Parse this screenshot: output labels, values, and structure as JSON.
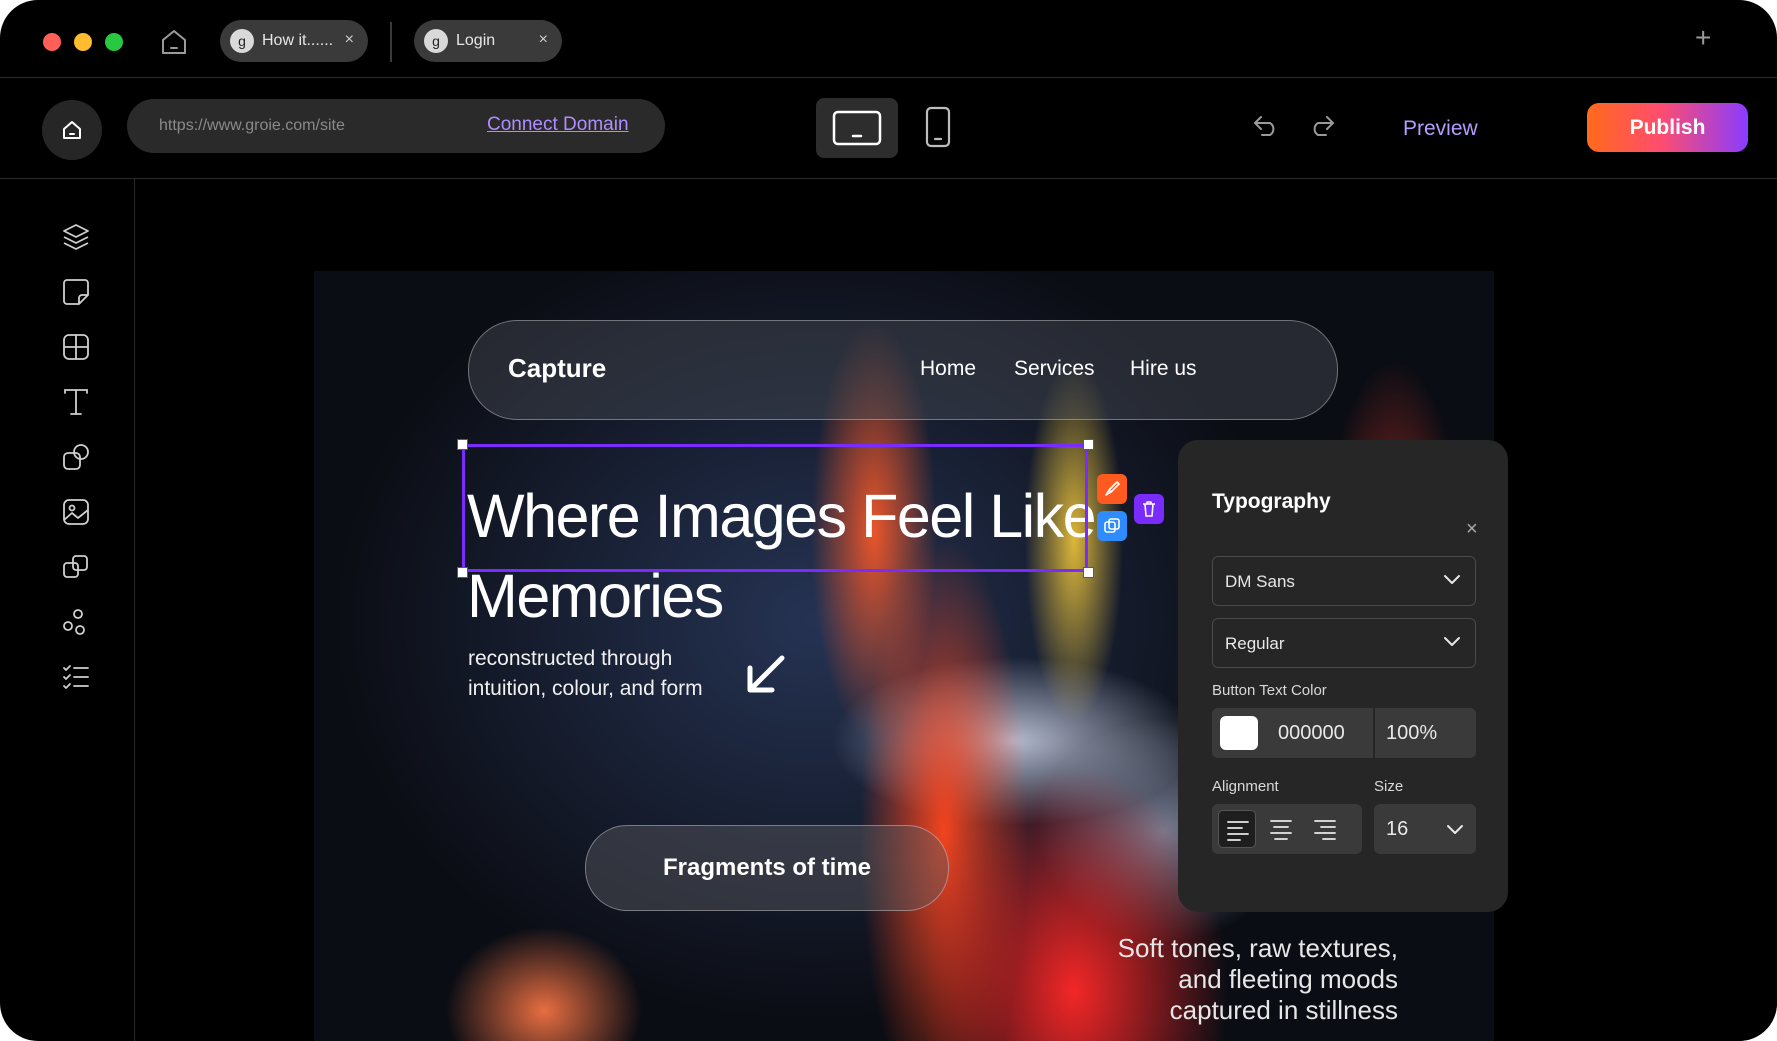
{
  "browser": {
    "tabs": [
      {
        "favicon": "g",
        "label": "How it......",
        "close": "×"
      },
      {
        "favicon": "g",
        "label": "Login",
        "close": "×"
      }
    ],
    "new_tab": "+"
  },
  "toolbar": {
    "url": "https://www.groie.com/site",
    "connect_domain": "Connect Domain",
    "preview": "Preview",
    "publish": "Publish"
  },
  "sidebar": {
    "icons": [
      "layers-icon",
      "pages-icon",
      "layout-grid-icon",
      "text-icon",
      "shapes-icon",
      "image-icon",
      "components-icon",
      "elements-icon",
      "checklist-icon"
    ]
  },
  "site": {
    "brand": "Capture",
    "nav": [
      "Home",
      "Services",
      "Hire us"
    ],
    "headline_line1": "Where Images Feel Like",
    "headline_line2": "Memories",
    "subtext_line1": "reconstructed through",
    "subtext_line2": "intuition, colour, and form",
    "cta": "Fragments of time",
    "tagline_line1": "Soft tones, raw textures,",
    "tagline_line2": "and fleeting moods",
    "tagline_line3": "captured in stillness"
  },
  "typography_panel": {
    "title": "Typography",
    "close": "×",
    "font_family": "DM Sans",
    "font_weight": "Regular",
    "button_text_color_label": "Button Text Color",
    "color_hex": "000000",
    "opacity": "100%",
    "alignment_label": "Alignment",
    "size_label": "Size",
    "size_value": "16",
    "active_alignment": "left"
  },
  "colors": {
    "accent_purple": "#7a2cff",
    "publish_gradient_start": "#ff6a1a",
    "publish_gradient_end": "#8a3cff",
    "edit_button": "#ff5a1f",
    "delete_button": "#7a2cff",
    "duplicate_button": "#2f8cff"
  }
}
